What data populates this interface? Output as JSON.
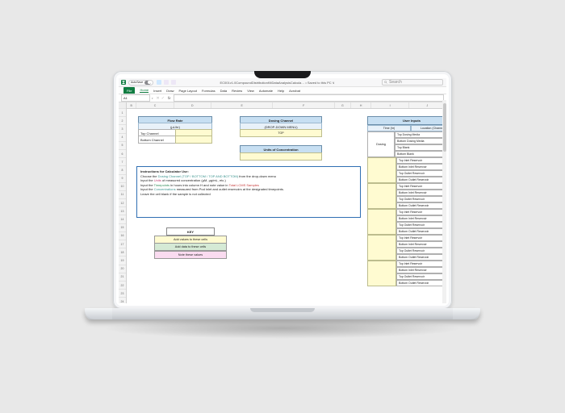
{
  "titlebar": {
    "autosave_label": "AutoSave",
    "autosave_state": "On",
    "doc_title": "EC001v1.0CompoundDistributionKitDataAnalysisCalcula… • Saved to this PC ∨",
    "search_placeholder": "Search"
  },
  "ribbon": [
    "File",
    "Home",
    "Insert",
    "Draw",
    "Page Layout",
    "Formulas",
    "Data",
    "Review",
    "View",
    "Automate",
    "Help",
    "Acrobat"
  ],
  "name_box": "A1",
  "columns": [
    "B",
    "C",
    "D",
    "E",
    "F",
    "G",
    "H",
    "I",
    "J"
  ],
  "rows_visible": 27,
  "flow_rate": {
    "header": "Flow Rate",
    "units": "(µL/hr)",
    "rows": [
      "Top Channel",
      "Bottom Channel"
    ]
  },
  "dosing_channel": {
    "header": "Dosing Channel",
    "sub": "(DROP-DOWN MENU)",
    "value": "TOP"
  },
  "units_conc": {
    "header": "Units of Concentration"
  },
  "instructions": {
    "title": "Instructions for Calculator Use:",
    "l1a": "Choose the ",
    "l1b": "Dosing Channel (TOP / BOTTOM / TOP AND BOTTOM)",
    "l1c": " from the drop-down menu",
    "l2a": "Input the ",
    "l2b": "Units",
    "l2c": " of measured concentration (µM, µg/mL, etc.)",
    "l3a": "Input the ",
    "l3b": "Timepoints",
    "l3c": " in hours into column H and note value in ",
    "l3d": "Total LCMS Samples",
    "l4a": "Input the ",
    "l4b": "Concentrations",
    "l4c": " measured from Pod inlet and outlet reservoirs at the designated timepoints.",
    "l5": "Leave the cell blank if the sample is not collected"
  },
  "key": {
    "title": "KEY",
    "rows": [
      {
        "label": "Add values to these cells",
        "cls": "cell-yellow"
      },
      {
        "label": "Add data to these cells",
        "cls": "cell-green"
      },
      {
        "label": "Note these values",
        "cls": "cell-pink"
      }
    ]
  },
  "user_inputs": {
    "title": "User Inputs",
    "time_h": "Time (hr)",
    "loc_h": "Location (Channel)",
    "dosing_label": "Dosing",
    "initial_rows": [
      "Top Dosing Media",
      "Bottom Dosing Media",
      "Top Blank",
      "Bottom Blank"
    ],
    "cycle": [
      "Top Inlet Reservoir",
      "Bottom Inlet Reservoir",
      "Top Outlet Reservoir",
      "Bottom Outlet Reservoir"
    ],
    "cycles": 5
  }
}
